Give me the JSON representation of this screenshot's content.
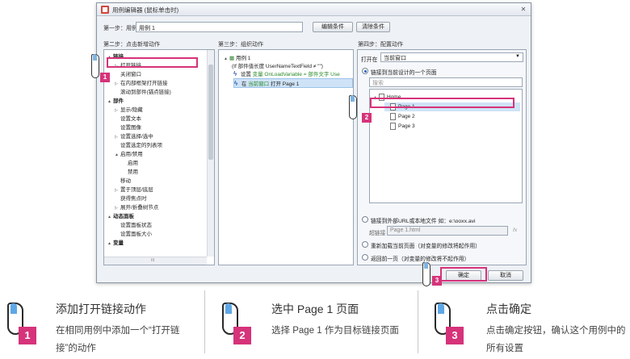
{
  "dialog": {
    "title": "用例编辑器 (鼠标单击时)",
    "step1": {
      "label": "第一步：用例说明",
      "value": "用例 1"
    },
    "edit_condition": "编辑条件",
    "clear_condition": "清除条件",
    "step2_label": "第二步：点击新增动作",
    "step3_label": "第三步：组织动作",
    "step4_label": "第四步：配置动作",
    "ok": "确定",
    "cancel": "取消",
    "scroll_indicator": "III"
  },
  "actions_tree": [
    {
      "label": "链接",
      "bold": true,
      "expander": "▲",
      "indent": 0
    },
    {
      "label": "打开链接",
      "expander": "▷",
      "indent": 1
    },
    {
      "label": "关闭窗口",
      "expander": "",
      "indent": 1
    },
    {
      "label": "在内部框架打开链接",
      "expander": "▷",
      "indent": 1
    },
    {
      "label": "滚动到部件(锚点链接)",
      "expander": "",
      "indent": 1
    },
    {
      "label": "部件",
      "bold": true,
      "expander": "▲",
      "indent": 0
    },
    {
      "label": "显示/隐藏",
      "expander": "▷",
      "indent": 1
    },
    {
      "label": "设置文本",
      "expander": "",
      "indent": 1
    },
    {
      "label": "设置图像",
      "expander": "",
      "indent": 1
    },
    {
      "label": "设置选择/选中",
      "expander": "▷",
      "indent": 1
    },
    {
      "label": "设置选定的列表项",
      "expander": "",
      "indent": 1
    },
    {
      "label": "启用/禁用",
      "expander": "▲",
      "indent": 1
    },
    {
      "label": "启用",
      "expander": "",
      "indent": 2
    },
    {
      "label": "禁用",
      "expander": "",
      "indent": 2
    },
    {
      "label": "移动",
      "expander": "",
      "indent": 1
    },
    {
      "label": "置于顶层/底层",
      "expander": "▷",
      "indent": 1
    },
    {
      "label": "获得焦点时",
      "expander": "",
      "indent": 1
    },
    {
      "label": "展开/折叠树节点",
      "expander": "▷",
      "indent": 1
    },
    {
      "label": "动态面板",
      "bold": true,
      "expander": "▲",
      "indent": 0
    },
    {
      "label": "设置面板状态",
      "expander": "",
      "indent": 1
    },
    {
      "label": "设置面板大小",
      "expander": "",
      "indent": 1
    },
    {
      "label": "变量",
      "bold": true,
      "expander": "▲",
      "indent": 0
    }
  ],
  "organize": {
    "case_label": "用例 1",
    "condition": "(If 部件值长度 UserNameTextField ≠ \"\")",
    "action1_prefix": "设置",
    "action1_green": "变量 OnLoadVariable = 部件文字 Use",
    "action2_prefix": "在",
    "action2_green": "当前窗口",
    "action2_suffix": "打开 Page 1"
  },
  "configure": {
    "open_in_label": "打开在",
    "open_in_value": "当前窗口",
    "opt_link_page": "链接到当前设计的一个页面",
    "search_placeholder": "搜索",
    "pages": [
      {
        "label": "Home",
        "indent": 0,
        "expander": "▲"
      },
      {
        "label": "Page 1",
        "indent": 1,
        "expander": ""
      },
      {
        "label": "Page 2",
        "indent": 1,
        "expander": ""
      },
      {
        "label": "Page 3",
        "indent": 1,
        "expander": ""
      }
    ],
    "opt_external": "链接到外部URL或本地文件 如：e:\\ooxx.avi",
    "hyperlink_label": "超链接",
    "hyperlink_value": "Page 1.html",
    "fx": "fx",
    "opt_reload": "重新加载当前页面（对变量的修改将起作用）",
    "opt_back": "返回前一页（对变量的修改将不起作用）"
  },
  "markers": {
    "m1": "1",
    "m2": "2",
    "m3": "3"
  },
  "steps": [
    {
      "num": "1",
      "title": "添加打开链接动作",
      "desc": "在相同用例中添加一个“打开链接”的动作"
    },
    {
      "num": "2",
      "title": "选中 Page 1 页面",
      "desc": "选择 Page 1 作为目标链接页面"
    },
    {
      "num": "3",
      "title": "点击确定",
      "desc": "点击确定按钮，确认这个用例中的所有设置"
    }
  ]
}
